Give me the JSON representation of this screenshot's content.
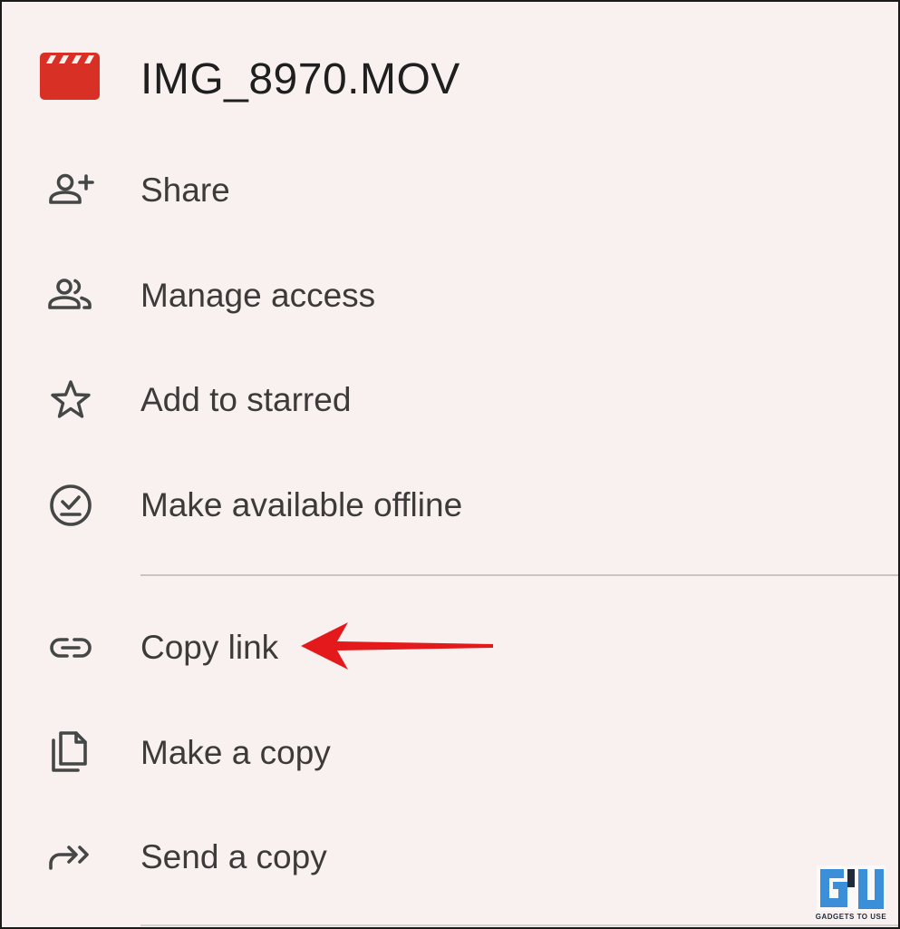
{
  "file": {
    "name": "IMG_8970.MOV",
    "icon": "video-clapperboard-icon",
    "icon_color": "#d93025"
  },
  "menu": {
    "items": [
      {
        "label": "Share",
        "icon": "person-add-icon"
      },
      {
        "label": "Manage access",
        "icon": "people-icon"
      },
      {
        "label": "Add to starred",
        "icon": "star-outline-icon"
      },
      {
        "label": "Make available offline",
        "icon": "offline-check-icon"
      },
      {
        "label": "Copy link",
        "icon": "link-icon"
      },
      {
        "label": "Make a copy",
        "icon": "copy-file-icon"
      },
      {
        "label": "Send a copy",
        "icon": "send-forward-icon"
      }
    ]
  },
  "colors": {
    "background": "#f9f1ef",
    "text": "#3d3a3a",
    "icon": "#444746",
    "annotation_arrow": "#e3191b"
  },
  "watermark": {
    "logo": "GU",
    "text": "GADGETS TO USE"
  }
}
